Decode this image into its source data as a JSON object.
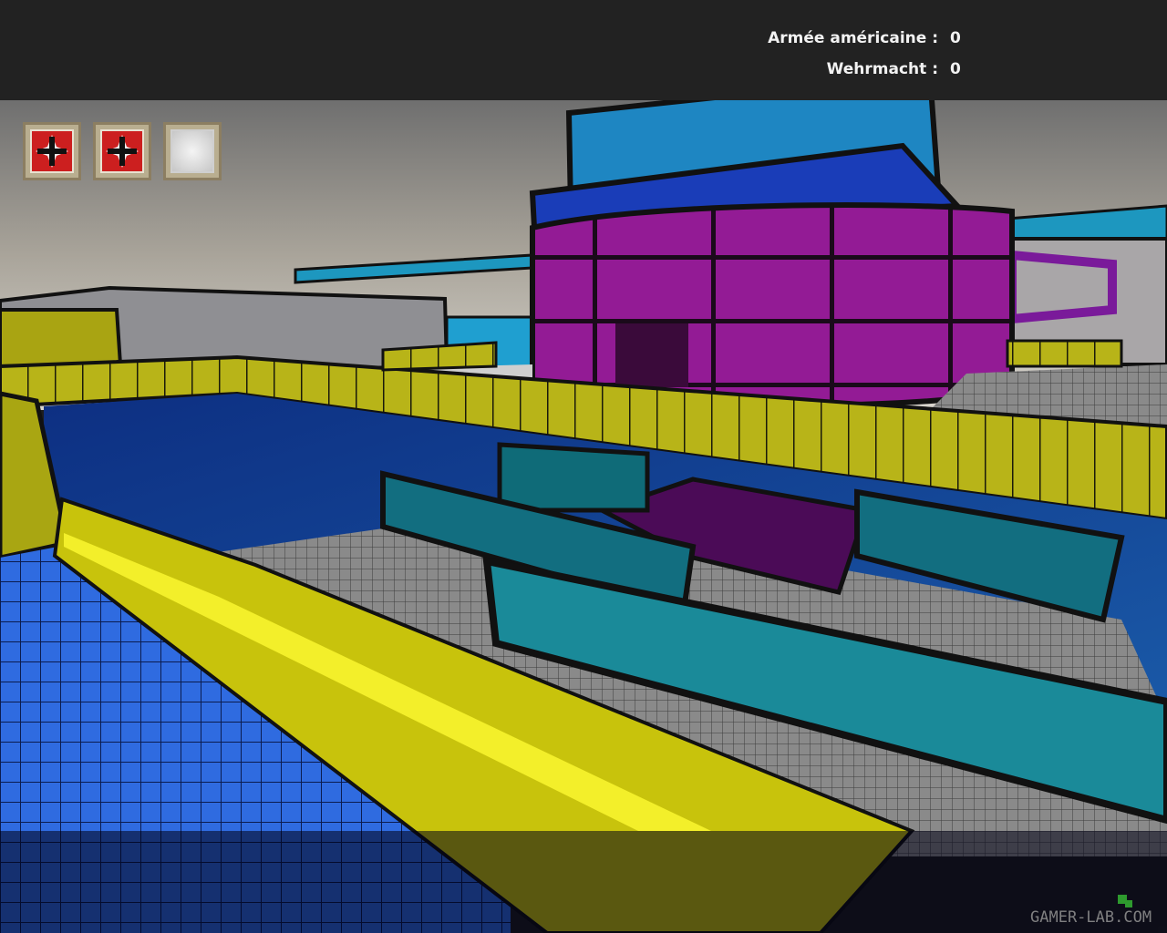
{
  "scoreboard": {
    "team_allies": {
      "label": "Armée américaine :",
      "score": "0"
    },
    "team_axis": {
      "label": "Wehrmacht :",
      "score": "0"
    }
  },
  "flags": [
    {
      "owner": "axis",
      "icon": "iron-cross-icon"
    },
    {
      "owner": "axis",
      "icon": "iron-cross-icon"
    },
    {
      "owner": "neutral",
      "icon": "neutral-flag-icon"
    }
  ],
  "watermark": {
    "text": "GAMER-LAB.COM"
  },
  "colors": {
    "hud_bar": "#222222",
    "axis_flag": "#cc1f1f",
    "level_yellow": "#c4c21a",
    "level_magenta": "#8a1a8c",
    "level_cyan": "#1a8a9a",
    "floor_blue": "#2f6be0"
  }
}
